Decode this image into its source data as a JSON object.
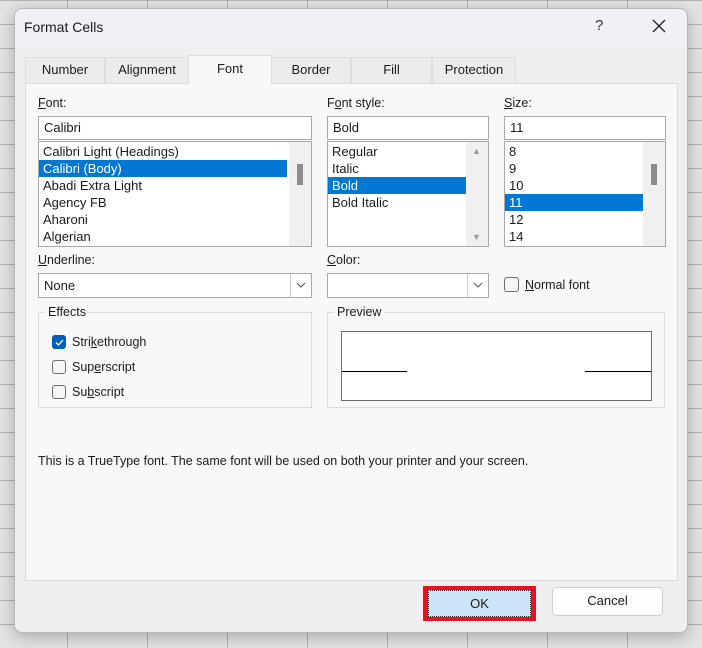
{
  "dialog": {
    "title": "Format Cells",
    "help_label": "?",
    "close_label": "✕"
  },
  "tabs": [
    {
      "label": "Number",
      "active": false
    },
    {
      "label": "Alignment",
      "active": false
    },
    {
      "label": "Font",
      "active": true
    },
    {
      "label": "Border",
      "active": false
    },
    {
      "label": "Fill",
      "active": false
    },
    {
      "label": "Protection",
      "active": false
    }
  ],
  "font": {
    "label_mnemonic": "F",
    "label_rest": "ont:",
    "value": "Calibri",
    "list": [
      "Calibri Light (Headings)",
      "Calibri (Body)",
      "Abadi Extra Light",
      "Agency FB",
      "Aharoni",
      "Algerian"
    ],
    "selected_index": 1
  },
  "font_style": {
    "label_pre": "F",
    "label_mnemonic": "o",
    "label_rest": "nt style:",
    "value": "Bold",
    "list": [
      "Regular",
      "Italic",
      "Bold",
      "Bold Italic"
    ],
    "selected_index": 2
  },
  "size": {
    "label_mnemonic": "S",
    "label_rest": "ize:",
    "value": "11",
    "list": [
      "8",
      "9",
      "10",
      "11",
      "12",
      "14"
    ],
    "selected_index": 3
  },
  "underline": {
    "label_mnemonic": "U",
    "label_rest": "nderline:",
    "value": "None"
  },
  "color": {
    "label_mnemonic": "C",
    "label_rest": "olor:",
    "value": ""
  },
  "normal_font": {
    "label_mnemonic": "N",
    "label_rest": "ormal font",
    "checked": false
  },
  "effects": {
    "title": "Effects",
    "items": [
      {
        "pre": "Stri",
        "mnemonic": "k",
        "rest": "ethrough",
        "checked": true
      },
      {
        "pre": "Sup",
        "mnemonic": "e",
        "rest": "rscript",
        "checked": false
      },
      {
        "pre": "Su",
        "mnemonic": "b",
        "rest": "script",
        "checked": false
      }
    ]
  },
  "preview": {
    "title": "Preview"
  },
  "info_text": "This is a TrueType font.  The same font will be used on both your printer and your screen.",
  "buttons": {
    "ok": "OK",
    "cancel": "Cancel"
  },
  "colors": {
    "selection": "#0078d4",
    "highlight_border": "#e81123",
    "checkbox_checked": "#005fb8",
    "ok_fill": "#cce4f7"
  }
}
